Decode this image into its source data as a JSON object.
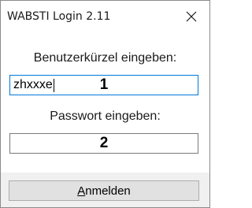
{
  "window": {
    "title": "WABSTI Login 2.11",
    "close_icon": "close-icon"
  },
  "form": {
    "username_label": "Benutzerkürzel eingeben:",
    "username_value": "zhxxxe",
    "username_marker": "1",
    "password_label": "Passwort eingeben:",
    "password_value": "",
    "password_marker": "2"
  },
  "footer": {
    "login_mnemonic": "A",
    "login_rest": "nmelden"
  },
  "colors": {
    "focus_border": "#0078d7",
    "footer_bg": "#f0f0f0",
    "button_bg": "#e1e1e1"
  }
}
